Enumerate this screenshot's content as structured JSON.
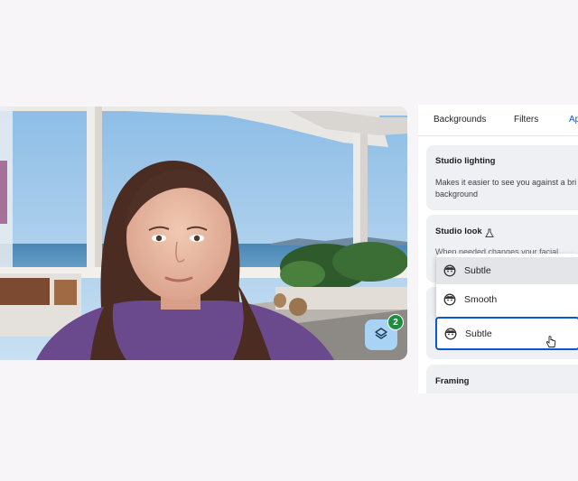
{
  "panel": {
    "tabs": [
      {
        "label": "Backgrounds",
        "active": false
      },
      {
        "label": "Filters",
        "active": false
      },
      {
        "label": "Ap",
        "active": true
      }
    ],
    "studio_lighting": {
      "title": "Studio lighting",
      "description": "Makes it easier to see you against a bri background"
    },
    "studio_look": {
      "title": "Studio look",
      "icon": "flask-icon",
      "description_partial": "When needed changes your facial..."
    },
    "dropdown": {
      "options": [
        {
          "label": "Subtle",
          "icon": "face-icon",
          "highlighted": true
        },
        {
          "label": "Smooth",
          "icon": "face-icon",
          "highlighted": false
        }
      ],
      "selected": {
        "label": "Subtle",
        "icon": "face-icon"
      }
    },
    "framing": {
      "title": "Framing"
    }
  },
  "video": {
    "effects_button_icon": "layers-icon",
    "effects_badge": "2"
  },
  "colors": {
    "accent": "#0b57d0",
    "badge": "#1e8e3e",
    "effects_button": "#a8d3f5",
    "card_bg": "#eef0f4"
  }
}
